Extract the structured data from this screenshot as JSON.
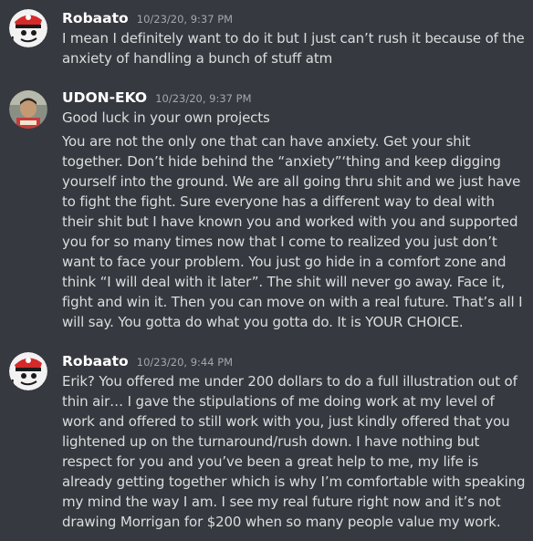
{
  "messages": [
    {
      "author": "Robaato",
      "timestamp": "10/23/20, 9:37 PM",
      "lines": [
        "I mean I definitely want to do it but I just can’t rush it because of the anxiety of handling a bunch of stuff atm"
      ]
    },
    {
      "author": "UDON-EKO",
      "timestamp": "10/23/20, 9:37 PM",
      "lines": [
        "Good luck in your own projects",
        "You are not the only one that can have anxiety. Get your shit together. Don’t hide behind the “anxiety”‘thing and keep digging yourself into the ground. We are all going thru shit and  we just have to fight the fight. Sure everyone has a different way to deal with their shit but I have known you and worked with you and supported you for so many times now that I come to realized you just don’t want to face your problem. You just go hide in a comfort zone and think “I will deal with it later”. The shit will never go away. Face it, fight and win it. Then you can move on with a real future. That’s all I will say. You gotta do what you gotta do. It is YOUR CHOICE."
      ]
    },
    {
      "author": "Robaato",
      "timestamp": "10/23/20, 9:44 PM",
      "lines": [
        "Erik? You offered me under 200 dollars to do a full illustration out of thin air… I gave the stipulations of me doing work at my level of work and offered to still work with you, just kindly offered that you lightened up on the turnaround/rush down. I have nothing but respect for you and you’ve been a great help to me, my life is already getting together which is why I’m comfortable with speaking my mind the way I am. I see my real future right now and it’s not drawing Morrigan for $200 when so many people value my work."
      ]
    }
  ],
  "colors": {
    "background": "#36393f",
    "username": "#ffffff",
    "timestamp": "#a3a6aa",
    "message_text": "#dcddde"
  },
  "icons": {
    "avatar_robaato": "cartoon-face-red-cap-avatar",
    "avatar_udon_eko": "photo-portrait-avatar"
  }
}
